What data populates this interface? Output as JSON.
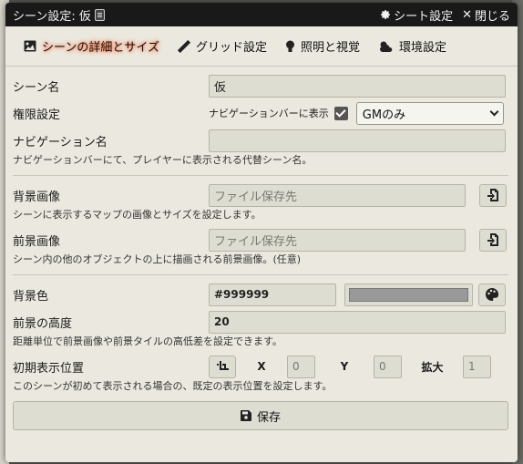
{
  "window": {
    "title": "シーン設定: 仮",
    "sheet_button": "シート設定",
    "close_button": "閉じる"
  },
  "tabs": [
    {
      "label": "シーンの詳細とサイズ",
      "icon": "image-icon",
      "active": true
    },
    {
      "label": "グリッド設定",
      "icon": "ruler-icon",
      "active": false
    },
    {
      "label": "照明と視覚",
      "icon": "lightbulb-icon",
      "active": false
    },
    {
      "label": "環境設定",
      "icon": "cloud-sun-icon",
      "active": false
    }
  ],
  "form": {
    "scene_name": {
      "label": "シーン名",
      "value": "仮"
    },
    "permission": {
      "label": "権限設定",
      "navbar_label": "ナビゲーションバーに表示",
      "navbar_checked": true,
      "select_value": "GMのみ"
    },
    "nav_name": {
      "label": "ナビゲーション名",
      "value": "",
      "hint": "ナビゲーションバーにて、プレイヤーに表示される代替シーン名。"
    },
    "background": {
      "label": "背景画像",
      "placeholder": "ファイル保存先",
      "hint": "シーンに表示するマップの画像とサイズを設定します。"
    },
    "foreground": {
      "label": "前景画像",
      "placeholder": "ファイル保存先",
      "hint": "シーン内の他のオブジェクトの上に描画される前景画像。(任意)"
    },
    "bg_color": {
      "label": "背景色",
      "value": "#999999",
      "swatch": "#999999"
    },
    "fg_elevation": {
      "label": "前景の高度",
      "value": "20",
      "hint": "距離単位で前景画像や前景タイルの高低差を設定できます。"
    },
    "initial_view": {
      "label": "初期表示位置",
      "x_label": "X",
      "x_value": "0",
      "y_label": "Y",
      "y_value": "0",
      "zoom_label": "拡大",
      "zoom_value": "1",
      "hint": "このシーンが初めて表示される場合の、既定の表示位置を設定します。"
    }
  },
  "save_button": "保存",
  "colors": {
    "active_tab_glow": "#ff5a2a",
    "titlebar": "#191919",
    "panel": "#ebe9df"
  }
}
